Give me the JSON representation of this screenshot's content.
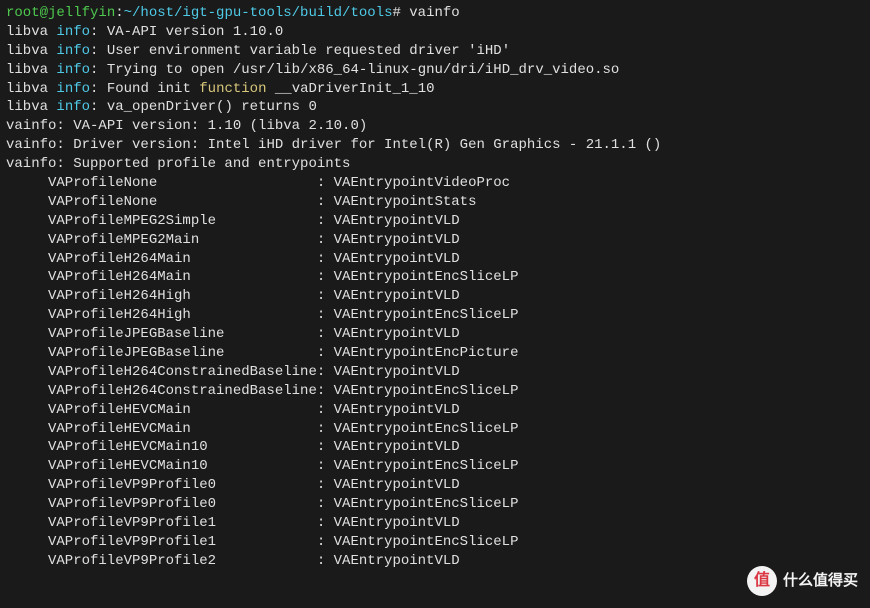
{
  "prompt": {
    "user": "root@jellfyin",
    "sep1": ":",
    "path": "~/host/igt-gpu-tools/build/tools",
    "sep2": "#",
    "cmd": " vainfo"
  },
  "libva": {
    "prefix": "libva ",
    "info": "info",
    "colon": ": ",
    "lines": [
      "VA-API version 1.10.0",
      "User environment variable requested driver 'iHD'",
      "Trying to open /usr/lib/x86_64-linux-gnu/dri/iHD_drv_video.so"
    ],
    "found_init_prefix": "Found init ",
    "function_kw": "function",
    "found_init_suffix": " __vaDriverInit_1_10",
    "returns": "va_openDriver() returns 0"
  },
  "vainfo": {
    "version": "vainfo: VA-API version: 1.10 (libva 2.10.0)",
    "driver": "vainfo: Driver version: Intel iHD driver for Intel(R) Gen Graphics - 21.1.1 ()",
    "supported": "vainfo: Supported profile and entrypoints"
  },
  "profiles": [
    {
      "p": "VAProfileNone                   ",
      "e": "VAEntrypointVideoProc"
    },
    {
      "p": "VAProfileNone                   ",
      "e": "VAEntrypointStats"
    },
    {
      "p": "VAProfileMPEG2Simple            ",
      "e": "VAEntrypointVLD"
    },
    {
      "p": "VAProfileMPEG2Main              ",
      "e": "VAEntrypointVLD"
    },
    {
      "p": "VAProfileH264Main               ",
      "e": "VAEntrypointVLD"
    },
    {
      "p": "VAProfileH264Main               ",
      "e": "VAEntrypointEncSliceLP"
    },
    {
      "p": "VAProfileH264High               ",
      "e": "VAEntrypointVLD"
    },
    {
      "p": "VAProfileH264High               ",
      "e": "VAEntrypointEncSliceLP"
    },
    {
      "p": "VAProfileJPEGBaseline           ",
      "e": "VAEntrypointVLD"
    },
    {
      "p": "VAProfileJPEGBaseline           ",
      "e": "VAEntrypointEncPicture"
    },
    {
      "p": "VAProfileH264ConstrainedBaseline",
      "e": "VAEntrypointVLD"
    },
    {
      "p": "VAProfileH264ConstrainedBaseline",
      "e": "VAEntrypointEncSliceLP"
    },
    {
      "p": "VAProfileHEVCMain               ",
      "e": "VAEntrypointVLD"
    },
    {
      "p": "VAProfileHEVCMain               ",
      "e": "VAEntrypointEncSliceLP"
    },
    {
      "p": "VAProfileHEVCMain10             ",
      "e": "VAEntrypointVLD"
    },
    {
      "p": "VAProfileHEVCMain10             ",
      "e": "VAEntrypointEncSliceLP"
    },
    {
      "p": "VAProfileVP9Profile0            ",
      "e": "VAEntrypointVLD"
    },
    {
      "p": "VAProfileVP9Profile0            ",
      "e": "VAEntrypointEncSliceLP"
    },
    {
      "p": "VAProfileVP9Profile1            ",
      "e": "VAEntrypointVLD"
    },
    {
      "p": "VAProfileVP9Profile1            ",
      "e": "VAEntrypointEncSliceLP"
    },
    {
      "p": "VAProfileVP9Profile2            ",
      "e": "VAEntrypointVLD"
    }
  ],
  "watermark": {
    "badge": "值",
    "text": "什么值得买"
  }
}
